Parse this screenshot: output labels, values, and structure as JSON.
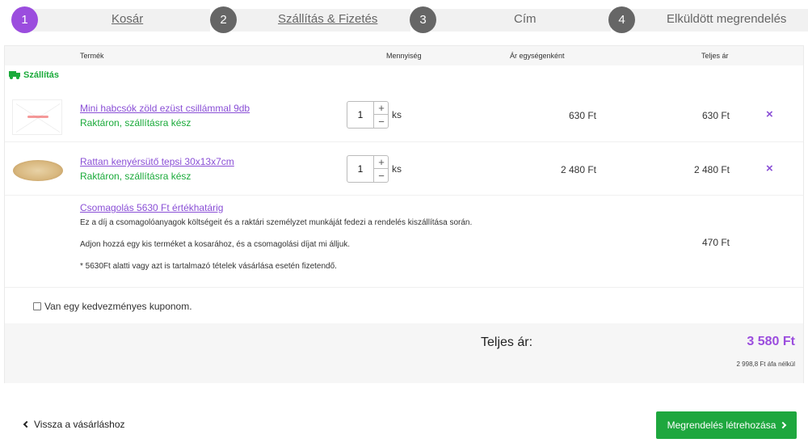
{
  "steps": [
    {
      "number": "1",
      "label": "Kosár"
    },
    {
      "number": "2",
      "label": "Szállítás & Fizetés"
    },
    {
      "number": "3",
      "label": "Cím"
    },
    {
      "number": "4",
      "label": "Elküldött megrendelés"
    }
  ],
  "table": {
    "headers": {
      "product": "Termék",
      "quantity": "Mennyiség",
      "unit_price": "Ár egységenként",
      "total_price": "Teljes ár"
    }
  },
  "shipping_label": "Szállítás",
  "items": [
    {
      "name": "Mini habcsók zöld ezüst csillámmal 9db",
      "stock": "Raktáron, szállításra kész",
      "qty": "1",
      "unit": "ks",
      "unit_price": "630 Ft",
      "total": "630 Ft"
    },
    {
      "name": "Rattan kenyérsütő tepsi 30x13x7cm",
      "stock": "Raktáron, szállításra kész",
      "qty": "1",
      "unit": "ks",
      "unit_price": "2 480 Ft",
      "total": "2 480 Ft"
    }
  ],
  "remove_icon": "×",
  "qty_plus": "+",
  "qty_minus": "−",
  "packaging": {
    "title": "Csomagolás 5630 Ft értékhatárig",
    "line1": "Ez a díj a csomagolóanyagok költségeit és a raktári személyzet munkáját fedezi a rendelés kiszállítása során.",
    "line2": "Adjon hozzá egy kis terméket a kosarához, és a csomagolási díjat mi álljuk.",
    "line3": "* 5630Ft alatti vagy azt is tartalmazó tételek vásárlása esetén fizetendő.",
    "price": "470 Ft"
  },
  "coupon_label": "Van egy kedvezményes kuponom.",
  "totals": {
    "label": "Teljes ár:",
    "value": "3 580 Ft",
    "net": "2 998,8 Ft áfa nélkül"
  },
  "footer": {
    "back_label": "Vissza a vásárláshoz",
    "submit_label": "Megrendelés létrehozása"
  },
  "colors": {
    "accent": "#9b4dde",
    "success": "#1aaa3a",
    "button": "#1ea73e"
  }
}
